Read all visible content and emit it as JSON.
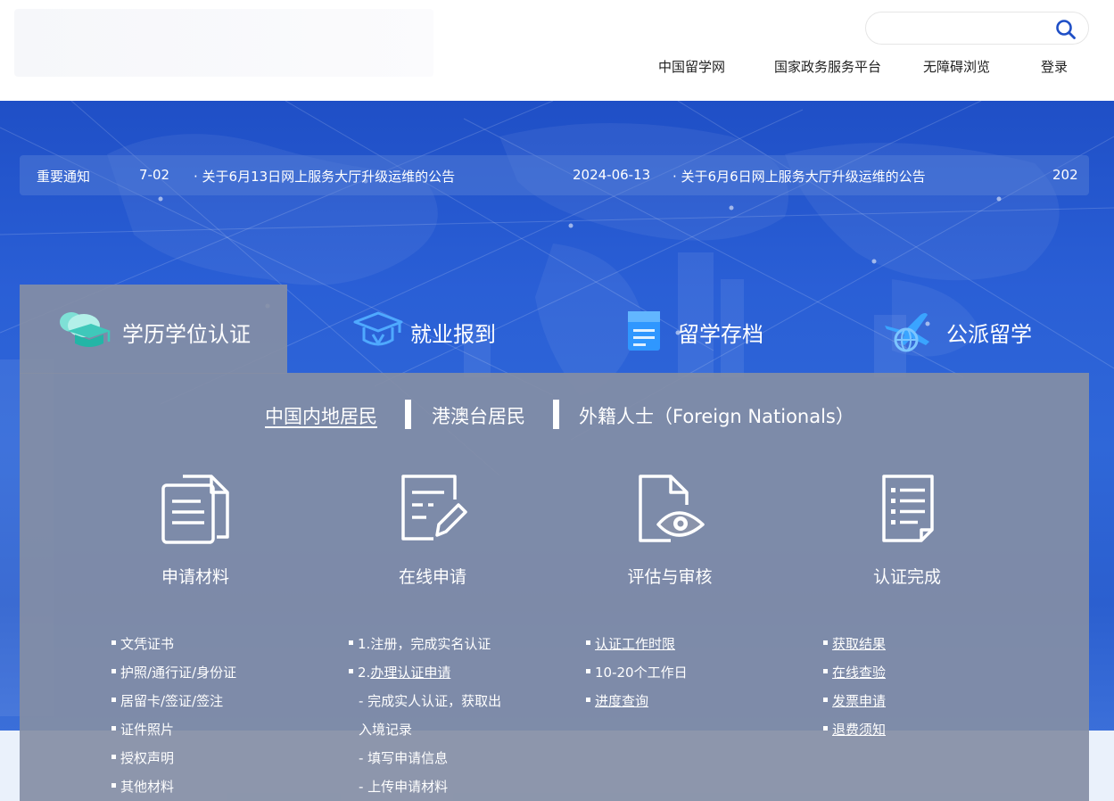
{
  "header": {
    "search": {
      "placeholder": ""
    },
    "nav": [
      "中国留学网",
      "国家政务服务平台",
      "无障碍浏览",
      "登录"
    ]
  },
  "notice": {
    "label": "重要通知",
    "items": [
      {
        "date": "7-02",
        "title": "· 关于6月13日网上服务大厅升级运维的公告"
      },
      {
        "date": "2024-06-13",
        "title": "· 关于6月6日网上服务大厅升级运维的公告"
      },
      {
        "date": "202",
        "title": ""
      }
    ]
  },
  "tabs": [
    {
      "label": "学历学位认证",
      "icon": "graduation-cap-icon",
      "active": true
    },
    {
      "label": "就业报到",
      "icon": "cap-badge-icon",
      "active": false
    },
    {
      "label": "留学存档",
      "icon": "archive-document-icon",
      "active": false
    },
    {
      "label": "公派留学",
      "icon": "plane-globe-icon",
      "active": false
    }
  ],
  "subtabs": [
    {
      "label": "中国内地居民",
      "active": true
    },
    {
      "label": "港澳台居民",
      "active": false
    },
    {
      "label": "外籍人士（Foreign Nationals）",
      "active": false
    }
  ],
  "columns": [
    {
      "title": "申请材料",
      "icon": "documents-icon",
      "items": [
        {
          "text": "文凭证书",
          "bullet": true,
          "link": false
        },
        {
          "text": "护照/通行证/身份证",
          "bullet": true,
          "link": false
        },
        {
          "text": "居留卡/签证/签注",
          "bullet": true,
          "link": false
        },
        {
          "text": "证件照片",
          "bullet": true,
          "link": false
        },
        {
          "text": "授权声明",
          "bullet": true,
          "link": false
        },
        {
          "text": "其他材料",
          "bullet": true,
          "link": false
        }
      ]
    },
    {
      "title": "在线申请",
      "icon": "edit-form-icon",
      "items": [
        {
          "prefix": "1.",
          "text": "注册，完成实名认证",
          "bullet": true,
          "link": false
        },
        {
          "prefix": "2.",
          "text": "办理认证申请",
          "bullet": true,
          "link": true
        },
        {
          "text": "- 完成实人认证，获取出",
          "bullet": false,
          "link": false
        },
        {
          "text": "入境记录",
          "bullet": false,
          "link": false
        },
        {
          "text": "- 填写申请信息",
          "bullet": false,
          "link": false
        },
        {
          "text": "- 上传申请材料",
          "bullet": false,
          "link": false
        }
      ]
    },
    {
      "title": "评估与审核",
      "icon": "document-eye-icon",
      "items": [
        {
          "text": "认证工作时限",
          "bullet": true,
          "link": true
        },
        {
          "text": "10-20个工作日",
          "bullet": true,
          "link": false
        },
        {
          "text": "进度查询",
          "bullet": true,
          "link": true
        }
      ]
    },
    {
      "title": "认证完成",
      "icon": "checklist-icon",
      "items": [
        {
          "text": "获取结果",
          "bullet": true,
          "link": true
        },
        {
          "text": "在线查验",
          "bullet": true,
          "link": true
        },
        {
          "text": "发票申请",
          "bullet": true,
          "link": true
        },
        {
          "text": "退费须知",
          "bullet": true,
          "link": true
        }
      ]
    }
  ]
}
